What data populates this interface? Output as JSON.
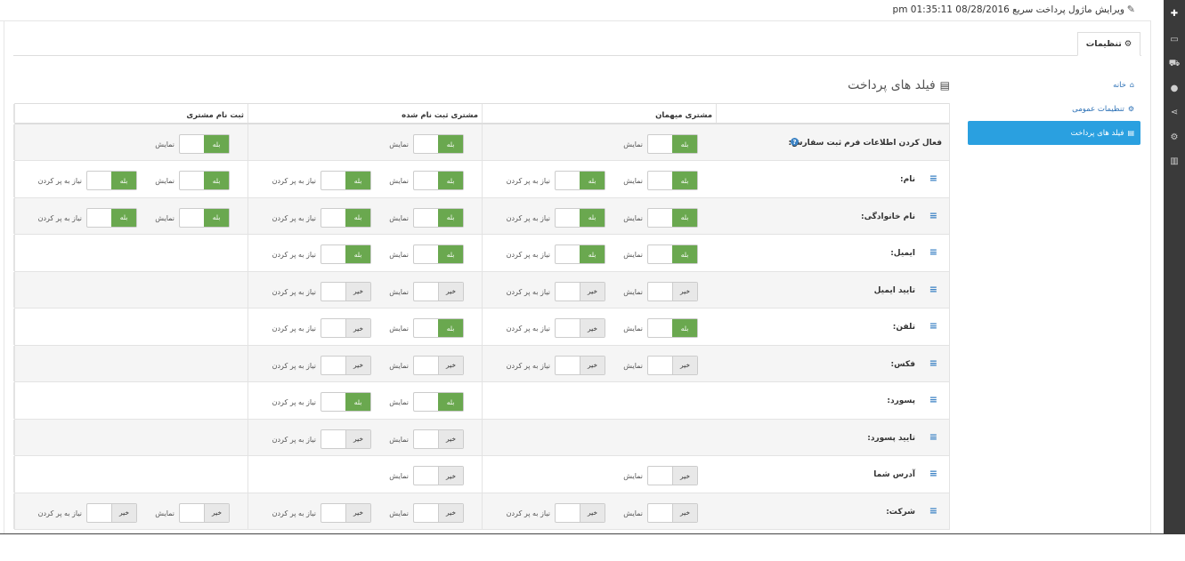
{
  "header": {
    "title": "ویرایش ماژول پرداخت سریع 08/28/2016 01:35:11 pm"
  },
  "tabs": [
    {
      "label": "تنظیمات"
    }
  ],
  "sidebar": {
    "items": [
      {
        "label": "خانه",
        "icon": "home-icon"
      },
      {
        "label": "تنظیمات عمومی",
        "icon": "gear-icon"
      },
      {
        "label": "فیلد های پرداخت",
        "icon": "book-icon",
        "active": true
      }
    ]
  },
  "section": {
    "title": "فیلد های پرداخت"
  },
  "columns": [
    "مشتری میهمان",
    "مشتری ثبت نام شده",
    "ثبت نام مشتری"
  ],
  "labels": {
    "show": "نمایش",
    "required": "نیاز به پر کردن",
    "yes": "بله",
    "no": "خیر"
  },
  "colors": {
    "accent": "#2aa0e0",
    "on": "#6aa84f",
    "rail": "#3a3a3a"
  },
  "rows": [
    {
      "label": "فعال کردن اطلاعات فرم ثبت سفارش:",
      "help": true,
      "g": [
        "on",
        null
      ],
      "r": [
        "on",
        null
      ],
      "c": [
        "on",
        null
      ]
    },
    {
      "label": "نام:",
      "g": [
        "on",
        "on"
      ],
      "r": [
        "on",
        "on"
      ],
      "c": [
        "on",
        "on"
      ]
    },
    {
      "label": "نام خانوادگی:",
      "g": [
        "on",
        "on"
      ],
      "r": [
        "on",
        "on"
      ],
      "c": [
        "on",
        "on"
      ]
    },
    {
      "label": "ایمیل:",
      "g": [
        "on",
        "on"
      ],
      "r": [
        "on",
        "on"
      ],
      "c": null
    },
    {
      "label": "تایید ایمیل",
      "g": [
        "off",
        "off"
      ],
      "r": [
        "off",
        "off"
      ],
      "c": null
    },
    {
      "label": "تلفن:",
      "g": [
        "on",
        "off"
      ],
      "r": [
        "on",
        "off"
      ],
      "c": null
    },
    {
      "label": "فکس:",
      "g": [
        "off",
        "off"
      ],
      "r": [
        "off",
        "off"
      ],
      "c": null
    },
    {
      "label": "پسورد:",
      "g": null,
      "r": [
        "on",
        "on"
      ],
      "c": null
    },
    {
      "label": "تایید پسورد:",
      "g": null,
      "r": [
        "off",
        "off"
      ],
      "c": null
    },
    {
      "label": "آدرس شما",
      "g": [
        "off",
        null
      ],
      "r": [
        "off",
        null
      ],
      "c": null
    },
    {
      "label": "شرکت:",
      "g": [
        "off",
        "off"
      ],
      "r": [
        "off",
        "off"
      ],
      "c": [
        "off",
        "off"
      ]
    }
  ]
}
